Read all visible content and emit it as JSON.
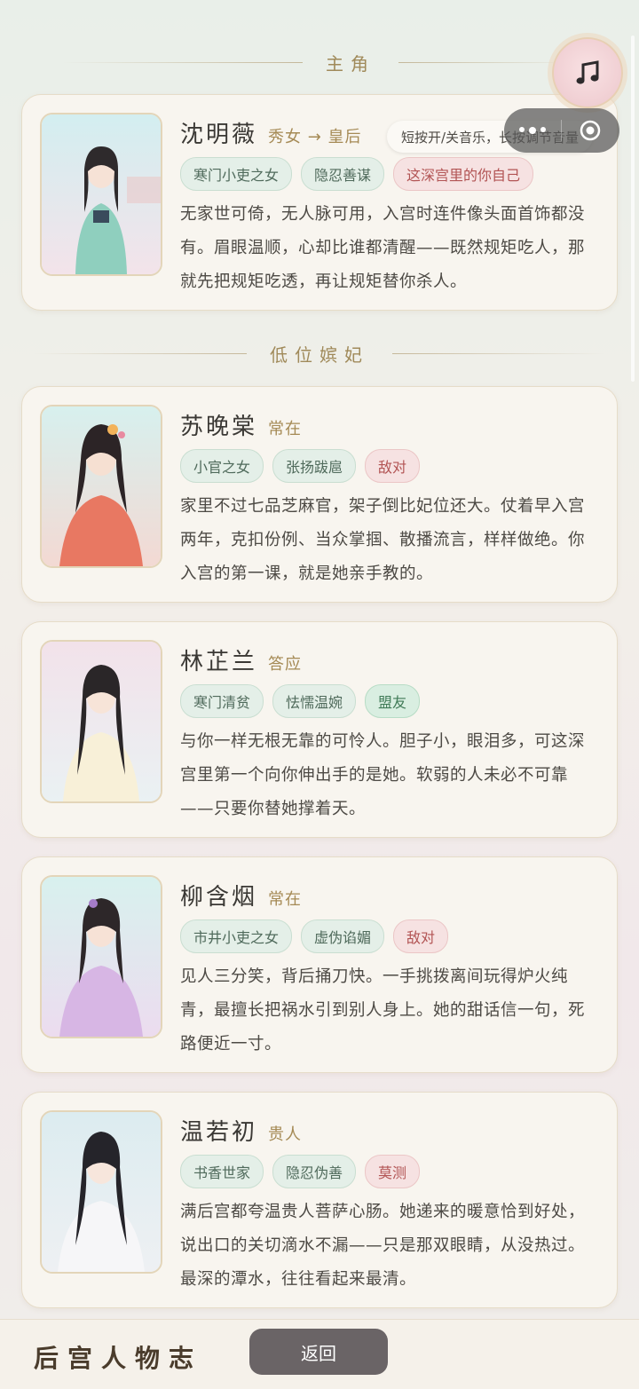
{
  "sections": [
    {
      "title": "主角"
    },
    {
      "title": "低位嫔妃"
    }
  ],
  "music": {
    "icon": "music-note-icon",
    "tooltip": "短按开/关音乐，长按调节音量"
  },
  "characters": [
    {
      "name": "沈明薇",
      "rank": "秀女 → 皇后",
      "tags": [
        "寒门小吏之女",
        "隐忍善谋",
        "这深宫里的你自己"
      ],
      "desc": "无家世可倚，无人脉可用，入宫时连件像头面首饰都没有。眉眼温顺，心却比谁都清醒——既然规矩吃人，那就先把规矩吃透，再让规矩替你杀人。",
      "portrait_colors": [
        "#d3eef0",
        "#f3e3ea"
      ]
    },
    {
      "name": "苏晚棠",
      "rank": "常在",
      "tags": [
        "小官之女",
        "张扬跋扈",
        "敌对"
      ],
      "desc": "家里不过七品芝麻官，架子倒比妃位还大。仗着早入宫两年，克扣份例、当众掌掴、散播流言，样样做绝。你入宫的第一课，就是她亲手教的。",
      "portrait_colors": [
        "#d7f0ee",
        "#f3d9d3"
      ]
    },
    {
      "name": "林芷兰",
      "rank": "答应",
      "tags": [
        "寒门清贫",
        "怯懦温婉",
        "盟友"
      ],
      "desc": "与你一样无根无靠的可怜人。胆子小，眼泪多，可这深宫里第一个向你伸出手的是她。软弱的人未必不可靠——只要你替她撑着天。",
      "portrait_colors": [
        "#f2e2ea",
        "#eaf1f3"
      ]
    },
    {
      "name": "柳含烟",
      "rank": "常在",
      "tags": [
        "市井小吏之女",
        "虚伪谄媚",
        "敌对"
      ],
      "desc": "见人三分笑，背后捅刀快。一手挑拨离间玩得炉火纯青，最擅长把祸水引到别人身上。她的甜话信一句，死路便近一寸。",
      "portrait_colors": [
        "#d8f1ee",
        "#ecdcef"
      ]
    },
    {
      "name": "温若初",
      "rank": "贵人",
      "tags": [
        "书香世家",
        "隐忍伪善",
        "莫测"
      ],
      "desc": "满后宫都夸温贵人菩萨心肠。她递来的暖意恰到好处，说出口的关切滴水不漏——只是那双眼睛，从没热过。最深的潭水，往往看起来最清。",
      "portrait_colors": [
        "#dcecf0",
        "#eef0f3"
      ]
    }
  ],
  "bottom": {
    "title": "后宫人物志",
    "back_label": "返回"
  }
}
